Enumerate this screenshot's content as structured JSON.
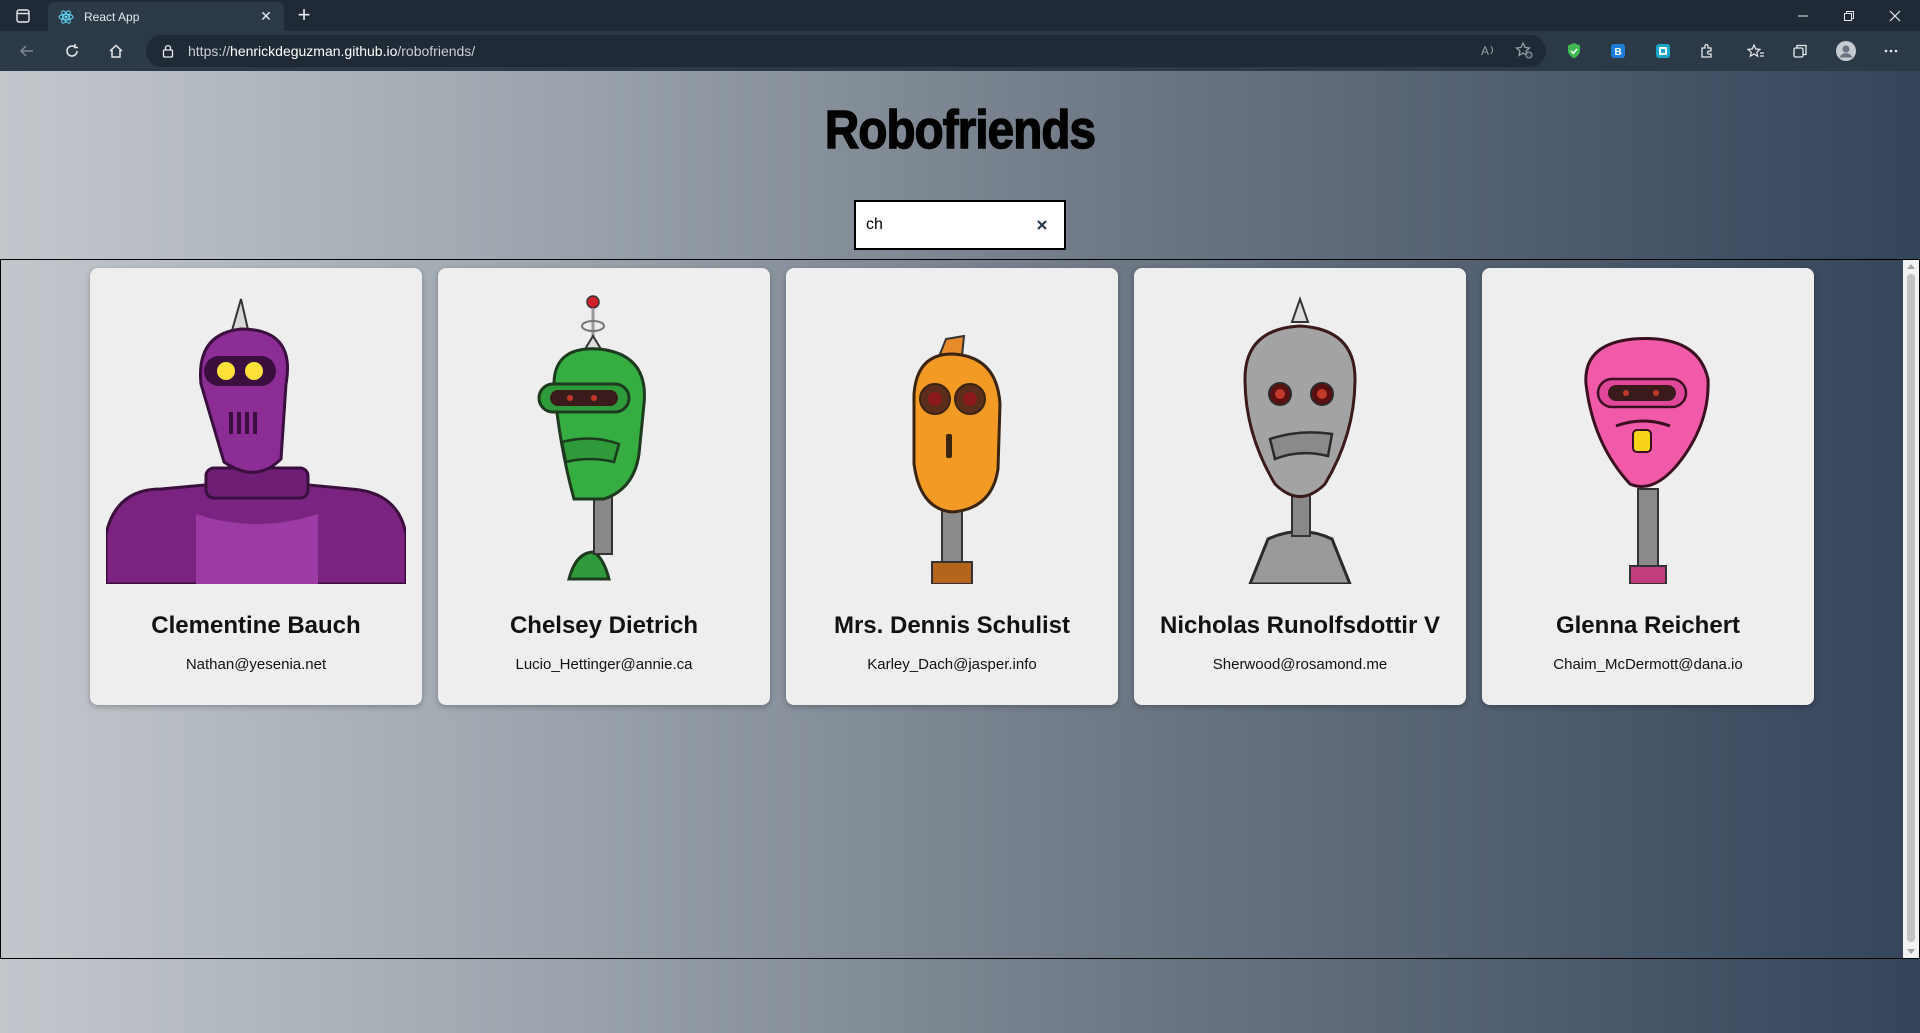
{
  "browser": {
    "tab_title": "React App",
    "url_prefix": "https://",
    "url_host": "henrickdeguzman.github.io",
    "url_path": "/robofriends/"
  },
  "app": {
    "title": "Robofriends",
    "search_value": "ch"
  },
  "robots": [
    {
      "name": "Clementine Bauch",
      "email": "Nathan@yesenia.net",
      "color": "#8a2a94"
    },
    {
      "name": "Chelsey Dietrich",
      "email": "Lucio_Hettinger@annie.ca",
      "color": "#33a83e"
    },
    {
      "name": "Mrs. Dennis Schulist",
      "email": "Karley_Dach@jasper.info",
      "color": "#f29a24"
    },
    {
      "name": "Nicholas Runolfsdottir V",
      "email": "Sherwood@rosamond.me",
      "color": "#9b9b9b"
    },
    {
      "name": "Glenna Reichert",
      "email": "Chaim_McDermott@dana.io",
      "color": "#f05aa8"
    }
  ]
}
